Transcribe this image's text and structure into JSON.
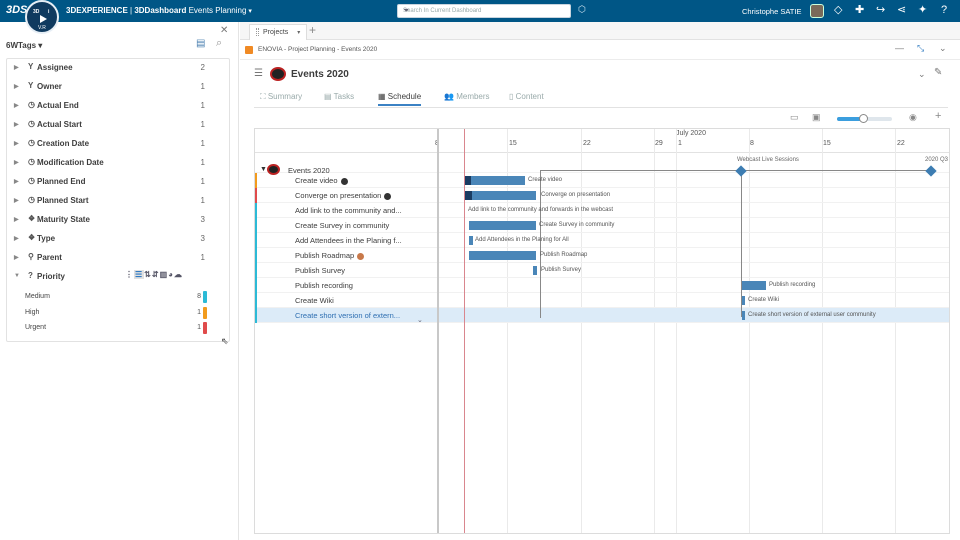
{
  "topbar": {
    "compass_version": "V.R",
    "brand_prefix": "3DEXPERIENCE",
    "brand_app": "3DDashboard",
    "dashboard_name": "Events Planning",
    "search_placeholder": "Search In Current Dashboard",
    "user_name": "Christophe SATIE"
  },
  "left_panel": {
    "title": "6WTags",
    "facets": [
      {
        "label": "Assignee",
        "count": "2",
        "icon": "funnel-icon"
      },
      {
        "label": "Owner",
        "count": "1",
        "icon": "funnel-icon"
      },
      {
        "label": "Actual End",
        "count": "1",
        "icon": "clock-icon"
      },
      {
        "label": "Actual Start",
        "count": "1",
        "icon": "clock-icon"
      },
      {
        "label": "Creation Date",
        "count": "1",
        "icon": "clock-icon"
      },
      {
        "label": "Modification Date",
        "count": "1",
        "icon": "clock-icon"
      },
      {
        "label": "Planned End",
        "count": "1",
        "icon": "clock-icon"
      },
      {
        "label": "Planned Start",
        "count": "1",
        "icon": "clock-icon"
      },
      {
        "label": "Maturity State",
        "count": "3",
        "icon": "cubes-icon"
      },
      {
        "label": "Type",
        "count": "3",
        "icon": "cubes-icon"
      },
      {
        "label": "Parent",
        "count": "1",
        "icon": "pin-icon"
      },
      {
        "label": "Priority",
        "count": "",
        "icon": "question-icon"
      }
    ],
    "priority_values": [
      {
        "label": "Medium",
        "count": "8",
        "color": "#2cbad6"
      },
      {
        "label": "High",
        "count": "1",
        "color": "#f29b1d"
      },
      {
        "label": "Urgent",
        "count": "1",
        "color": "#e04b4b"
      }
    ]
  },
  "right_panel": {
    "tab_label": "Projects",
    "widget_title": "ENOVIA - Project Planning - Events 2020",
    "project_title": "Events 2020",
    "nav_tabs": [
      {
        "label": "Summary",
        "icon": "chart-icon",
        "active": false
      },
      {
        "label": "Tasks",
        "icon": "tasks-icon",
        "active": false
      },
      {
        "label": "Schedule",
        "icon": "calendar-icon",
        "active": true
      },
      {
        "label": "Members",
        "icon": "members-icon",
        "active": false
      },
      {
        "label": "Content",
        "icon": "document-icon",
        "active": false
      }
    ],
    "zoom_level": 0.45
  },
  "gantt": {
    "month_label": "July 2020",
    "date_ticks": [
      "8",
      "15",
      "22",
      "29",
      "1",
      "8",
      "15",
      "22"
    ],
    "root_task": "Events 2020",
    "tasks": [
      {
        "name": "Create video",
        "bar_label": "Create video",
        "flag": "#f29b1d",
        "avatar": true
      },
      {
        "name": "Converge on presentation",
        "bar_label": "Converge on presentation",
        "flag": "#e04b4b",
        "avatar": true
      },
      {
        "name": "Add link to the community and...",
        "bar_label": "Add link to the community and forwards in the webcast",
        "flag": "#2cbad6",
        "avatar": false
      },
      {
        "name": "Create Survey in community",
        "bar_label": "Create Survey in community",
        "flag": "#2cbad6",
        "avatar": false
      },
      {
        "name": "Add Attendees in the Planing f...",
        "bar_label": "Add Attendees in the Planing for All",
        "flag": "#2cbad6",
        "avatar": false
      },
      {
        "name": "Publish Roadmap",
        "bar_label": "Publish Roadmap",
        "flag": "#2cbad6",
        "avatar": true
      },
      {
        "name": "Publish Survey",
        "bar_label": "Publish Survey",
        "flag": "#2cbad6",
        "avatar": false
      },
      {
        "name": "Publish recording",
        "bar_label": "Publish recording",
        "flag": "#2cbad6",
        "avatar": false
      },
      {
        "name": "Create Wiki",
        "bar_label": "Create Wiki",
        "flag": "#2cbad6",
        "avatar": false
      },
      {
        "name": "Create short version of extern...",
        "bar_label": "Create short version of external user community",
        "flag": "#2cbad6",
        "avatar": false
      }
    ],
    "milestones": [
      "Webcast Live Sessions",
      "2020 Q3"
    ]
  }
}
